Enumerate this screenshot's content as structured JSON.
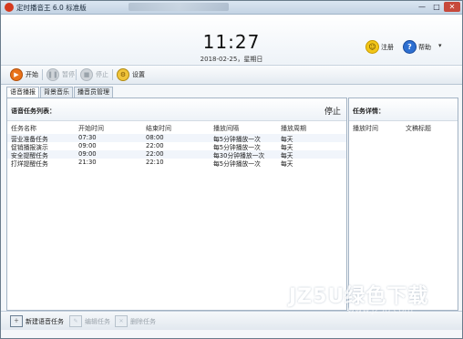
{
  "window": {
    "title": "定时播音王 6.0 标准版",
    "minimize": "—",
    "maximize": "□",
    "close": "✕"
  },
  "header": {
    "time": "11:27",
    "date": "2018-02-25，星期日",
    "register": "注册",
    "help": "帮助",
    "menu_caret": "▾"
  },
  "toolbar": {
    "start": "开始",
    "pause": "暂停",
    "stop": "停止",
    "settings": "设置"
  },
  "tabs": [
    {
      "label": "语音播报",
      "active": true
    },
    {
      "label": "背景音乐",
      "active": false
    },
    {
      "label": "播音员管理",
      "active": false
    }
  ],
  "task_list": {
    "title": "语音任务列表：",
    "status": "停止",
    "columns": [
      "任务名称",
      "开始时间",
      "结束时间",
      "播放间隔",
      "播放周期"
    ],
    "rows": [
      [
        "营业准备任务",
        "07:30",
        "08:00",
        "每5分钟播放一次",
        "每天"
      ],
      [
        "促销播报演示",
        "09:00",
        "22:00",
        "每5分钟播放一次",
        "每天"
      ],
      [
        "安全提醒任务",
        "09:00",
        "22:00",
        "每30分钟播放一次",
        "每天"
      ],
      [
        "打烊提醒任务",
        "21:30",
        "22:10",
        "每5分钟播放一次",
        "每天"
      ]
    ]
  },
  "task_detail": {
    "title": "任务详情：",
    "columns": [
      "播放时间",
      "文稿标题"
    ]
  },
  "bottom": {
    "new_task": "新建语音任务",
    "edit_task": "编辑任务",
    "delete_task": "删除任务"
  },
  "watermark": {
    "text": "JZ5U绿色下载",
    "sub": "www.jz5u.com"
  }
}
